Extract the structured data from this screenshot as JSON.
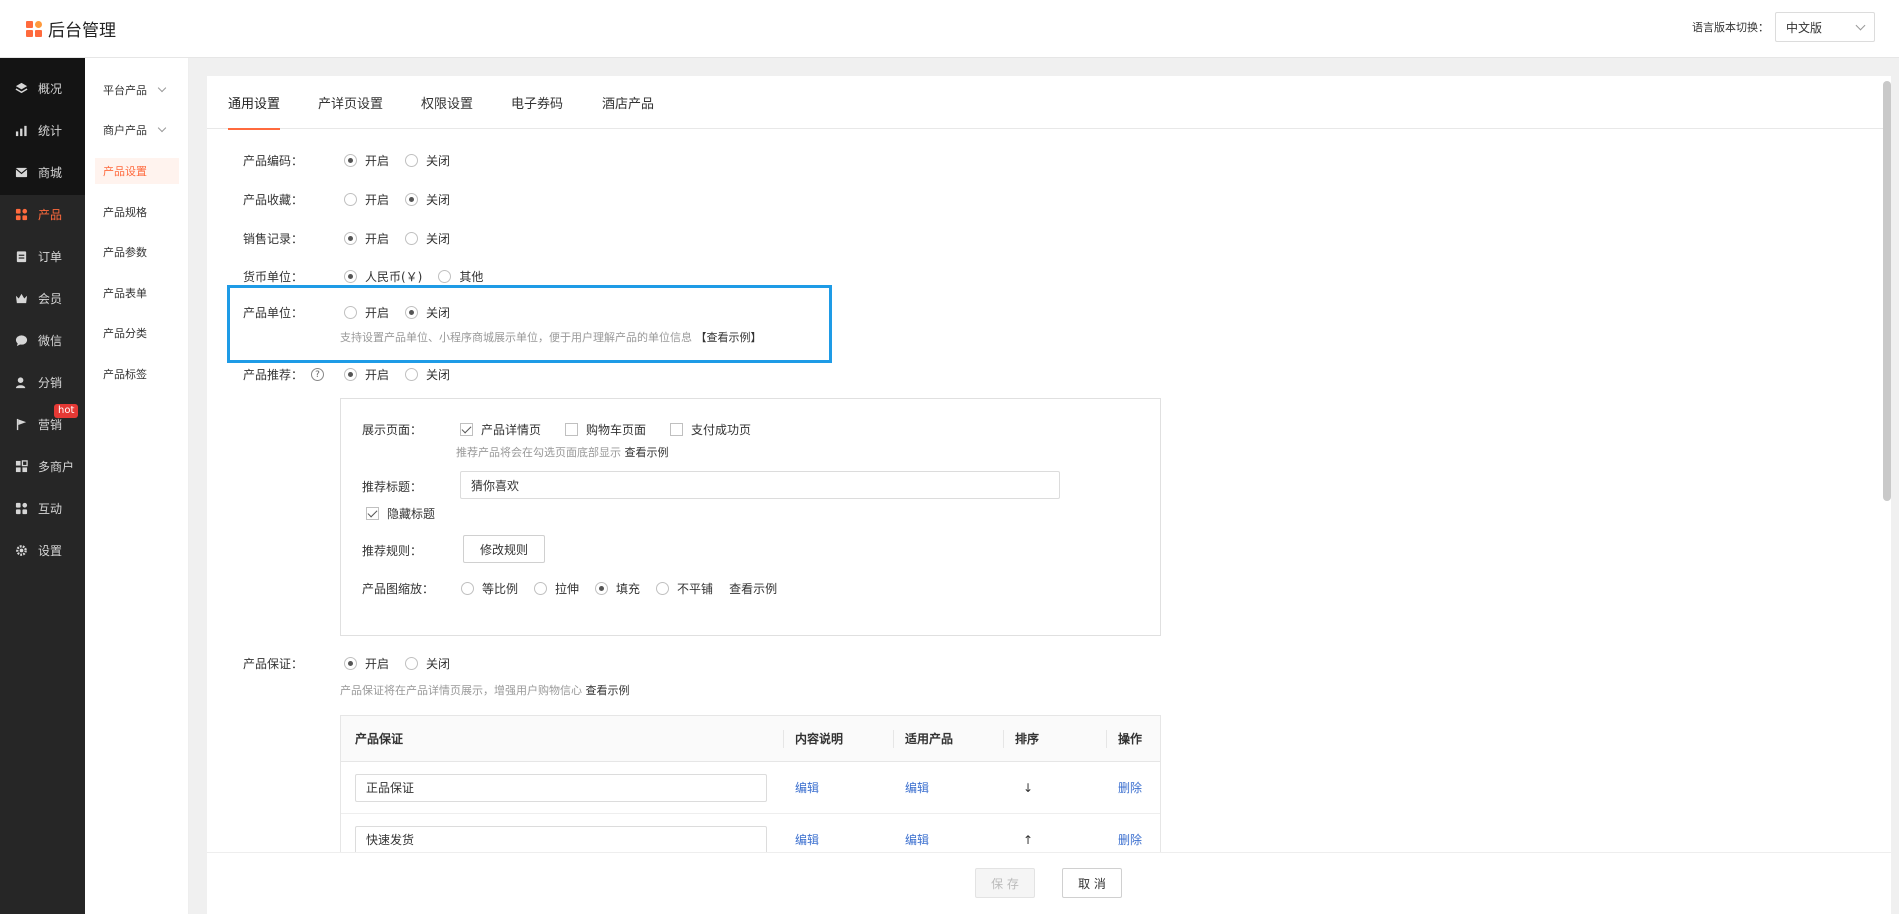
{
  "app": {
    "title": "后台管理"
  },
  "lang": {
    "label": "语言版本切换：",
    "value": "中文版"
  },
  "sidebar": {
    "items": [
      {
        "label": "概况",
        "icon": "layers-icon"
      },
      {
        "label": "统计",
        "icon": "chart-icon"
      },
      {
        "label": "商城",
        "icon": "mail-icon"
      },
      {
        "label": "产品",
        "icon": "grid-icon"
      },
      {
        "label": "订单",
        "icon": "clipboard-icon"
      },
      {
        "label": "会员",
        "icon": "crown-icon"
      },
      {
        "label": "微信",
        "icon": "chat-icon"
      },
      {
        "label": "分销",
        "icon": "user-icon"
      },
      {
        "label": "营销",
        "icon": "flag-icon"
      },
      {
        "label": "多商户",
        "icon": "store-icon"
      },
      {
        "label": "互动",
        "icon": "interact-icon"
      },
      {
        "label": "设置",
        "icon": "gear-icon"
      }
    ],
    "badge": "hot"
  },
  "subnav": {
    "items": [
      {
        "label": "平台产品"
      },
      {
        "label": "商户产品"
      },
      {
        "label": "产品设置"
      },
      {
        "label": "产品规格"
      },
      {
        "label": "产品参数"
      },
      {
        "label": "产品表单"
      },
      {
        "label": "产品分类"
      },
      {
        "label": "产品标签"
      }
    ]
  },
  "tabs": [
    "通用设置",
    "产详页设置",
    "权限设置",
    "电子券码",
    "酒店产品"
  ],
  "form": {
    "code": {
      "label": "产品编码：",
      "on": "开启",
      "off": "关闭"
    },
    "favorite": {
      "label": "产品收藏：",
      "on": "开启",
      "off": "关闭"
    },
    "sales": {
      "label": "销售记录：",
      "on": "开启",
      "off": "关闭"
    },
    "currency": {
      "label": "货币单位：",
      "opt1": "人民币(￥)",
      "opt2": "其他"
    },
    "unit": {
      "label": "产品单位：",
      "on": "开启",
      "off": "关闭",
      "hint": "支持设置产品单位、小程序商城展示单位，便于用户理解产品的单位信息",
      "example": "【查看示例】"
    },
    "recommend": {
      "label": "产品推荐：",
      "on": "开启",
      "off": "关闭"
    },
    "panel": {
      "pages_label": "展示页面：",
      "page1": "产品详情页",
      "page2": "购物车页面",
      "page3": "支付成功页",
      "pages_hint": "推荐产品将会在勾选页面底部显示",
      "pages_example": "查看示例",
      "title_label": "推荐标题：",
      "title_value": "猜你喜欢",
      "hide_title": "隐藏标题",
      "rule_label": "推荐规则：",
      "rule_btn": "修改规则",
      "scale_label": "产品图缩放：",
      "scale1": "等比例",
      "scale2": "拉伸",
      "scale3": "填充",
      "scale4": "不平铺",
      "scale_example": "查看示例"
    },
    "guarantee": {
      "label": "产品保证：",
      "on": "开启",
      "off": "关闭",
      "hint": "产品保证将在产品详情页展示，增强用户购物信心",
      "example": "查看示例"
    }
  },
  "table": {
    "headers": [
      "产品保证",
      "内容说明",
      "适用产品",
      "排序",
      "操作"
    ],
    "rows": [
      {
        "name": "正品保证",
        "desc": "编辑",
        "apply": "编辑",
        "sort": "↓",
        "op": "删除"
      },
      {
        "name": "快速发货",
        "desc": "编辑",
        "apply": "编辑",
        "sort": "↑",
        "op": "删除"
      }
    ]
  },
  "footer": {
    "save": "保 存",
    "cancel": "取 消"
  },
  "colors": {
    "accent": "#ff6a3d",
    "highlight": "#1e9be6",
    "sidebar": "#262626",
    "link": "#3b6fcf"
  }
}
